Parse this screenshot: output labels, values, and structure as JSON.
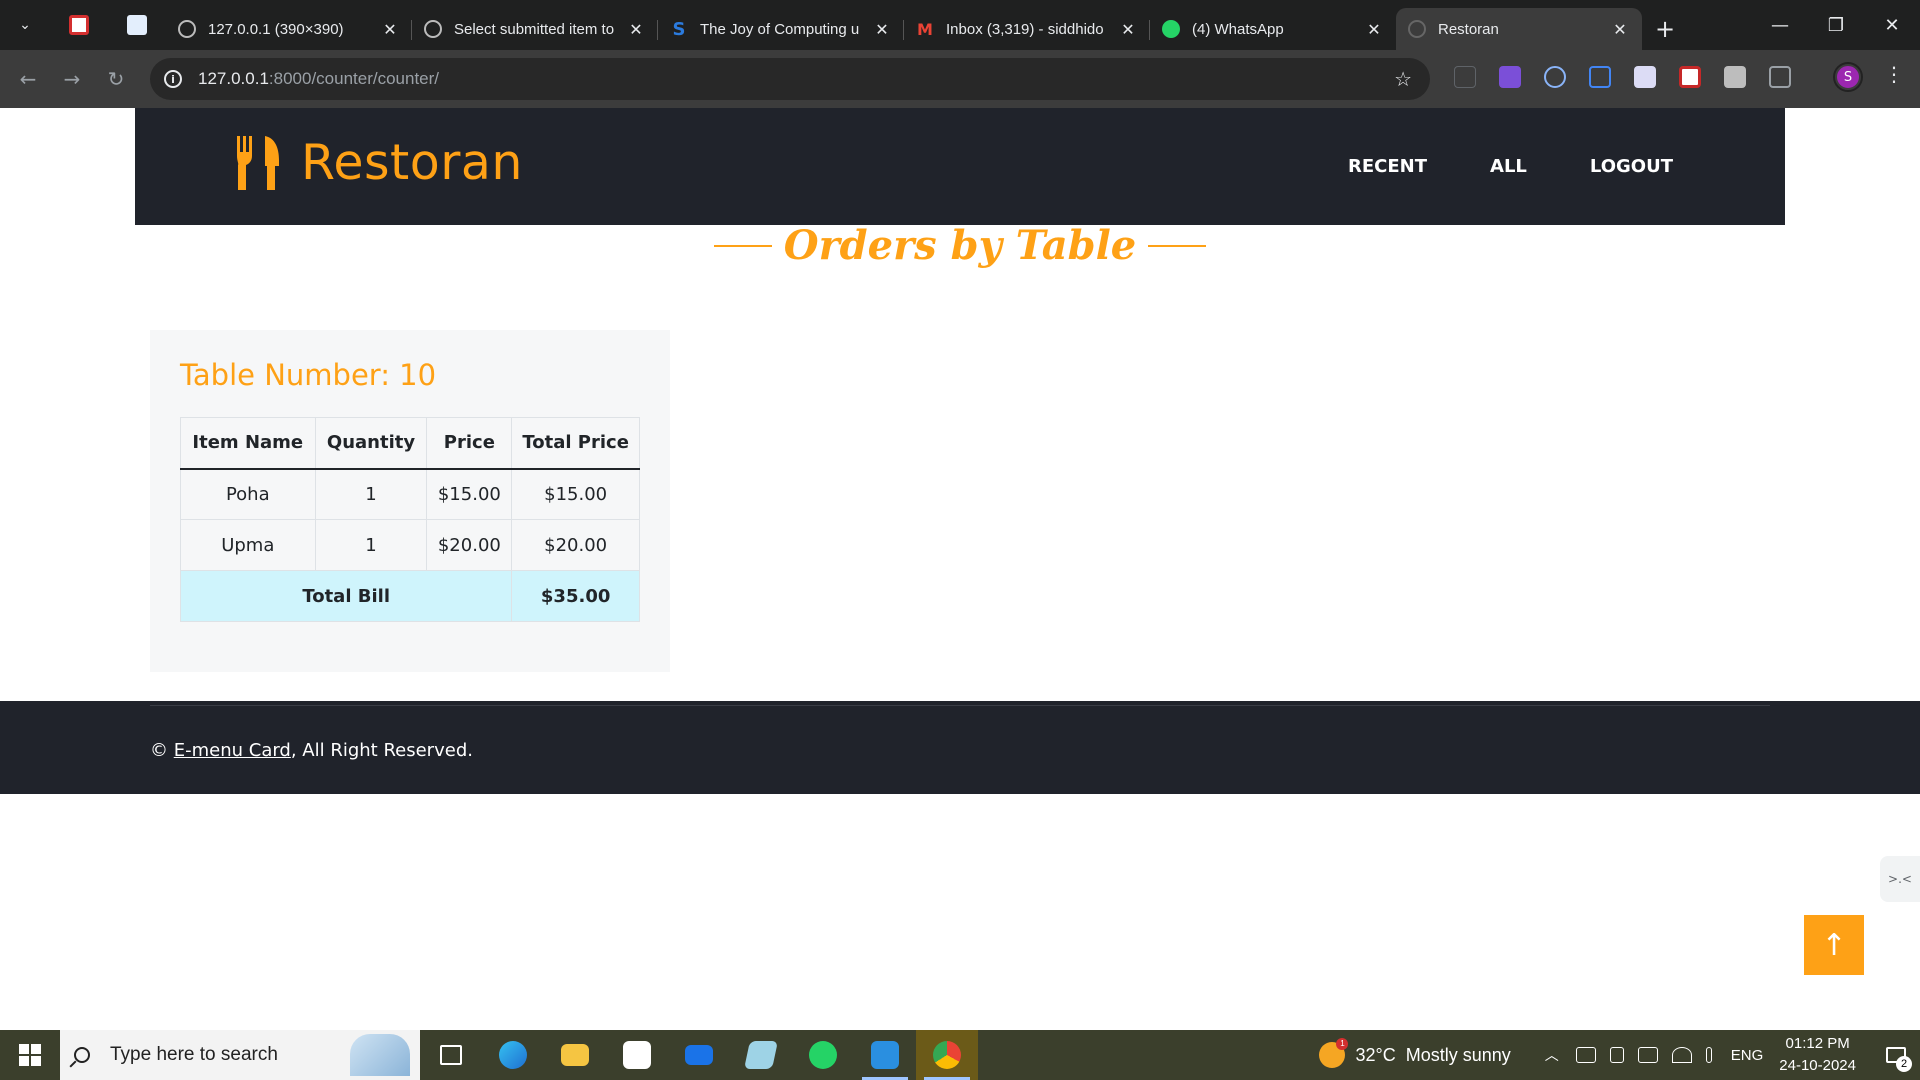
{
  "browser": {
    "tabs": [
      {
        "title": "127.0.0.1 (390×390)",
        "favicon": "globe-icon"
      },
      {
        "title": "Select submitted item to",
        "favicon": "globe-icon"
      },
      {
        "title": "The Joy of Computing u",
        "favicon": "swayam-icon"
      },
      {
        "title": "Inbox (3,319) - siddhido",
        "favicon": "gmail-icon"
      },
      {
        "title": "(4) WhatsApp",
        "favicon": "whatsapp-icon"
      },
      {
        "title": "Restoran",
        "favicon": "loading-icon",
        "active": true
      }
    ],
    "url_host": "127.0.0.1",
    "url_path": ":8000/counter/counter/",
    "profile_initial": "S"
  },
  "site": {
    "brand": "Restoran",
    "nav": [
      "RECENT",
      "ALL",
      "LOGOUT"
    ],
    "section_title": "Orders by Table",
    "accent": "#fea116",
    "dark": "#20232b"
  },
  "order": {
    "table_label": "Table Number: 10",
    "columns": [
      "Item Name",
      "Quantity",
      "Price",
      "Total Price"
    ],
    "rows": [
      {
        "item": "Poha",
        "qty": "1",
        "price": "$15.00",
        "total": "$15.00"
      },
      {
        "item": "Upma",
        "qty": "1",
        "price": "$20.00",
        "total": "$20.00"
      }
    ],
    "total_label": "Total Bill",
    "total_value": "$35.00"
  },
  "footer": {
    "prefix": "©",
    "link": "E-menu Card",
    "suffix": ", All Right Reserved."
  },
  "taskbar": {
    "search_placeholder": "Type here to search",
    "weather": "32°C  Mostly sunny",
    "weather_badge": "1",
    "lang": "ENG",
    "time": "01:12 PM",
    "date": "24-10-2024",
    "notifications": "2"
  }
}
